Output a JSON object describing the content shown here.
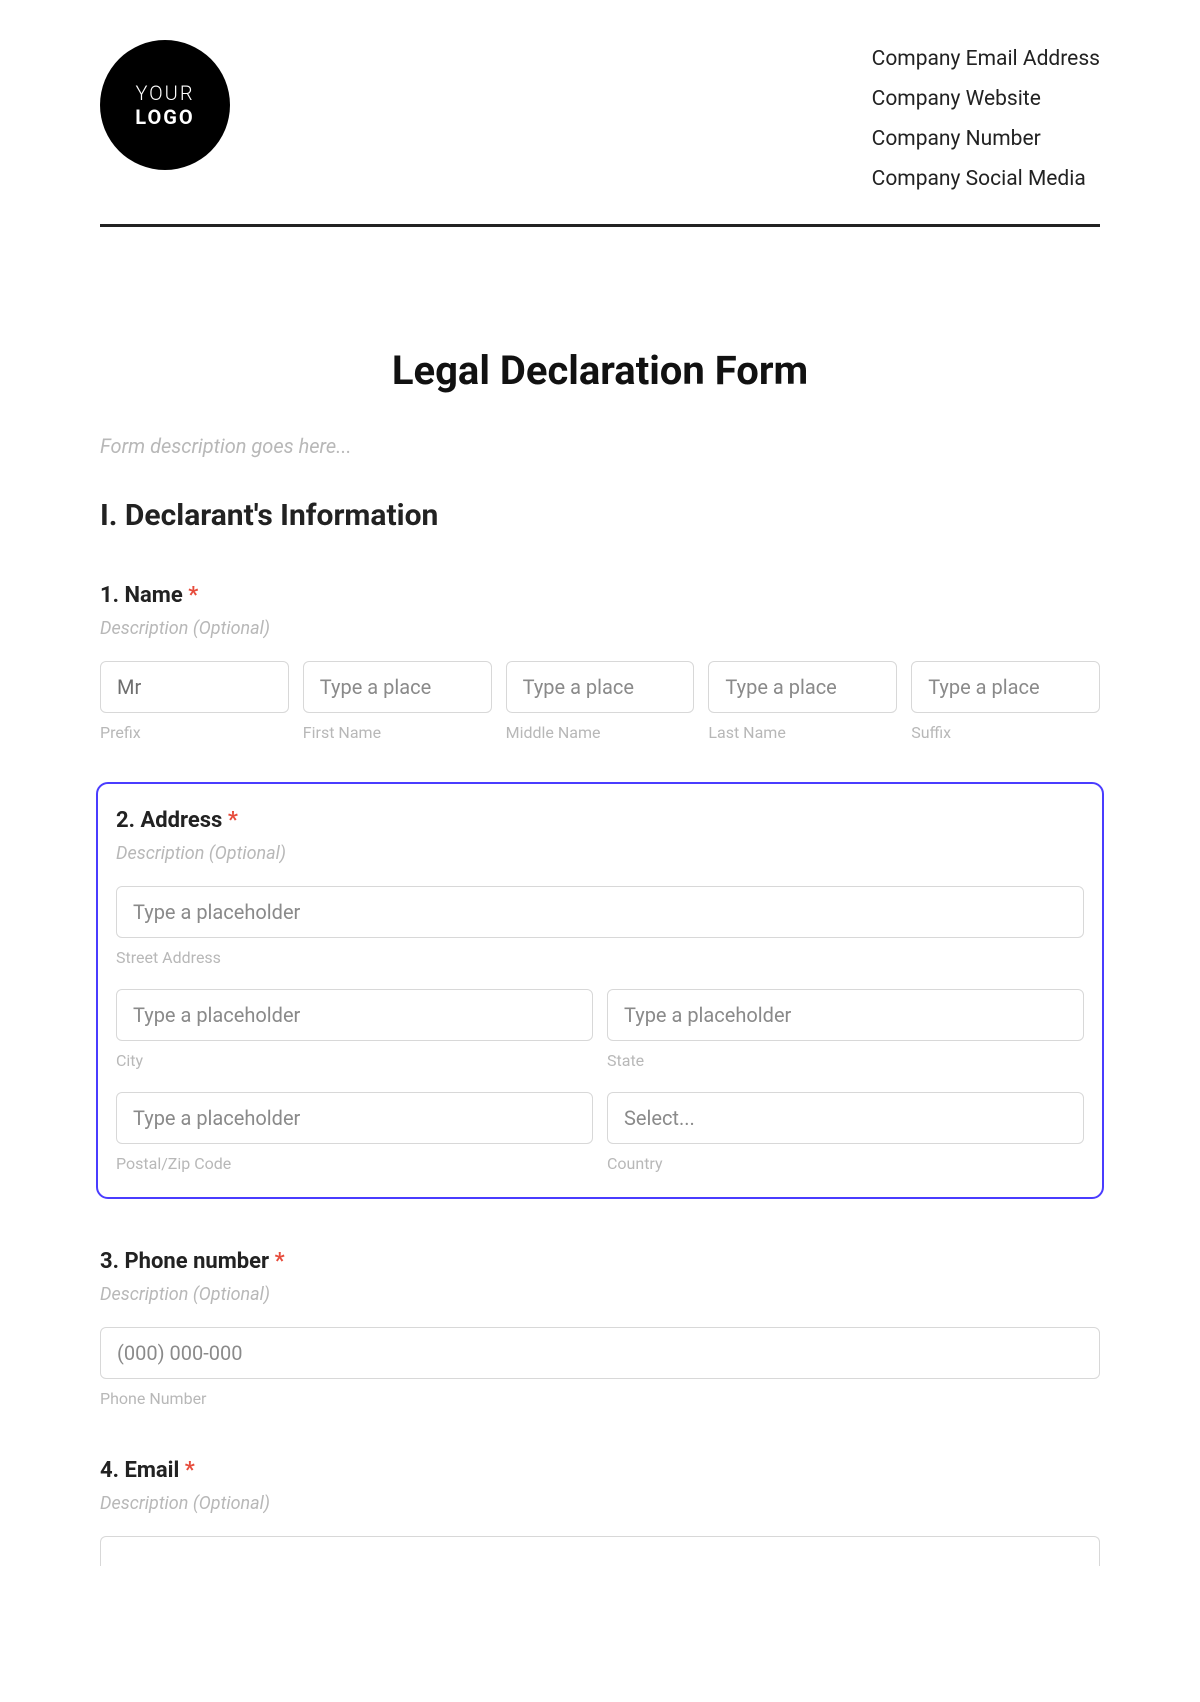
{
  "header": {
    "logo_line1": "YOUR",
    "logo_line2": "LOGO",
    "company": {
      "email": "Company Email Address",
      "website": "Company Website",
      "number": "Company Number",
      "social": "Company Social Media"
    }
  },
  "form": {
    "title": "Legal Declaration Form",
    "description": "Form description goes here...",
    "section1_title": "I. Declarant's Information",
    "name": {
      "label": "1. Name",
      "required": "*",
      "desc": "Description (Optional)",
      "prefix_value": "Mr",
      "first_placeholder": "Type a place",
      "middle_placeholder": "Type a place",
      "last_placeholder": "Type a place",
      "suffix_placeholder": "Type a place",
      "sub_prefix": "Prefix",
      "sub_first": "First Name",
      "sub_middle": "Middle Name",
      "sub_last": "Last Name",
      "sub_suffix": "Suffix"
    },
    "address": {
      "label": "2. Address",
      "required": "*",
      "desc": "Description (Optional)",
      "street_placeholder": "Type a placeholder",
      "city_placeholder": "Type a placeholder",
      "state_placeholder": "Type a placeholder",
      "postal_placeholder": "Type a placeholder",
      "country_placeholder": "Select...",
      "sub_street": "Street Address",
      "sub_city": "City",
      "sub_state": "State",
      "sub_postal": "Postal/Zip Code",
      "sub_country": "Country"
    },
    "phone": {
      "label": "3. Phone number",
      "required": "*",
      "desc": "Description (Optional)",
      "placeholder": "(000) 000-000",
      "sub": "Phone Number"
    },
    "email": {
      "label": "4. Email",
      "required": "*",
      "desc": "Description (Optional)"
    }
  }
}
